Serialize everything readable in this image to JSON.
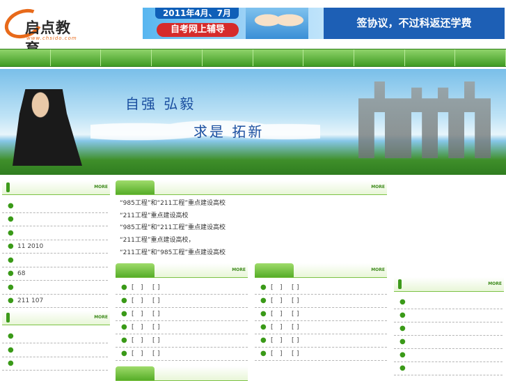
{
  "header": {
    "logo_name": "启点教育",
    "logo_url": "www.chsido.com",
    "banner_date": "2011年4月、7月",
    "banner_sub": "自考网上辅导",
    "banner_slogan": "签协议，不过科返还学费"
  },
  "nav": [
    "",
    "",
    "",
    "",
    "",
    "",
    "",
    "",
    "",
    ""
  ],
  "hero": {
    "line1": "自强  弘毅",
    "line2": "求是  拓新"
  },
  "more_label": "MORE",
  "left_list": {
    "items": [
      {
        "text": ""
      },
      {
        "text": ""
      },
      {
        "text": ""
      },
      {
        "text": "11   2010"
      },
      {
        "text": ""
      },
      {
        "text": "68"
      },
      {
        "text": ""
      },
      {
        "text": "211      107"
      }
    ]
  },
  "left_list2": {
    "items": [
      {
        "text": ""
      },
      {
        "text": ""
      },
      {
        "text": ""
      }
    ]
  },
  "intro": {
    "lines": [
      "“985工程”和“211工程”重点建设高校",
      "“211工程”重点建设高校",
      "“985工程”和“211工程”重点建设高校",
      "“211工程”重点建设高校，",
      "“211工程”和“985工程”重点建设高校"
    ]
  },
  "mid_left_list": {
    "items": [
      {
        "a": "[",
        "b": "]",
        "c": "[",
        "d": "]"
      },
      {
        "a": "[",
        "b": "]",
        "c": "[",
        "d": "]"
      },
      {
        "a": "[",
        "b": "]",
        "c": "[",
        "d": "]"
      },
      {
        "a": "[",
        "b": "]",
        "c": "[",
        "d": "]"
      },
      {
        "a": "[",
        "b": "]",
        "c": "[",
        "d": "]"
      },
      {
        "a": "[",
        "b": "]",
        "c": "[",
        "d": "]"
      }
    ]
  },
  "mid_right_list": {
    "items": [
      {
        "a": "[",
        "b": "]",
        "c": "[",
        "d": "]"
      },
      {
        "a": "[",
        "b": "]",
        "c": "[",
        "d": "]"
      },
      {
        "a": "[",
        "b": "]",
        "c": "[",
        "d": "]"
      },
      {
        "a": "[",
        "b": "]",
        "c": "[",
        "d": "]"
      },
      {
        "a": "[",
        "b": "]",
        "c": "[",
        "d": "]"
      },
      {
        "a": "[",
        "b": "]",
        "c": "[",
        "d": "]"
      }
    ]
  },
  "right_list": {
    "items": [
      {
        "text": ""
      },
      {
        "text": ""
      },
      {
        "text": ""
      },
      {
        "text": ""
      },
      {
        "text": ""
      },
      {
        "text": ""
      }
    ]
  },
  "colors": {
    "nav_green": "#3f9b22",
    "accent_green": "#56ad28",
    "banner_blue": "#1d5fb5",
    "banner_red": "#d62b2b",
    "logo_orange": "#e86a1a"
  }
}
